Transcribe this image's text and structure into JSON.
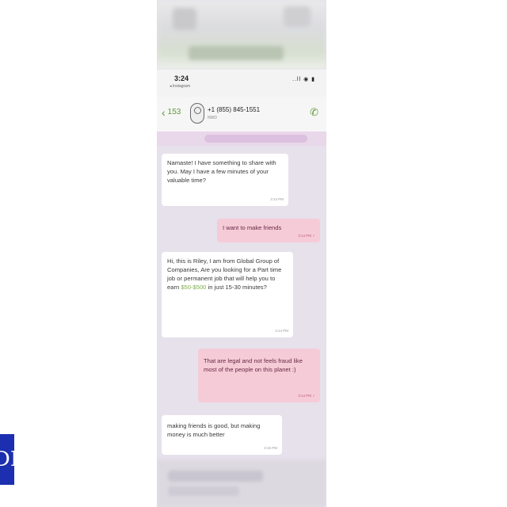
{
  "status": {
    "time": "3:24",
    "subnote": "◂ Instagram",
    "icons": "..ll ◉ ▮"
  },
  "header": {
    "back_label": "153",
    "contact": "+1 (855) 845-1551",
    "contact_sub": "NWD"
  },
  "messages": [
    {
      "dir": "in",
      "text": "Namaste! I have something to share with you. May I have a few minutes of your valuable time?",
      "time": "3:14 PM"
    },
    {
      "dir": "out",
      "text": "I want to make friends",
      "time": "3:14 PM ✓"
    },
    {
      "dir": "in",
      "text_pre": "Hi, this is Riley, I am from Global Group of Companies, Are you looking for a Part time job or permanent job that will help you to earn ",
      "money": "$50-$500",
      "text_post": " in just 15-30 minutes?",
      "time": "3:14 PM"
    },
    {
      "dir": "out",
      "text": "That are legal and not feels fraud like most of the people on this planet :)",
      "time": "3:14 PM ✓"
    },
    {
      "dir": "in",
      "text": "making friends is good, but making money is much better",
      "time": "3:15 PM"
    }
  ],
  "logo": {
    "text": "DI",
    "color": "#1c2fb0"
  },
  "colors": {
    "accent": "#5d9b3a",
    "outgoing": "#f5cbd7",
    "background": "#e6e1ea"
  }
}
